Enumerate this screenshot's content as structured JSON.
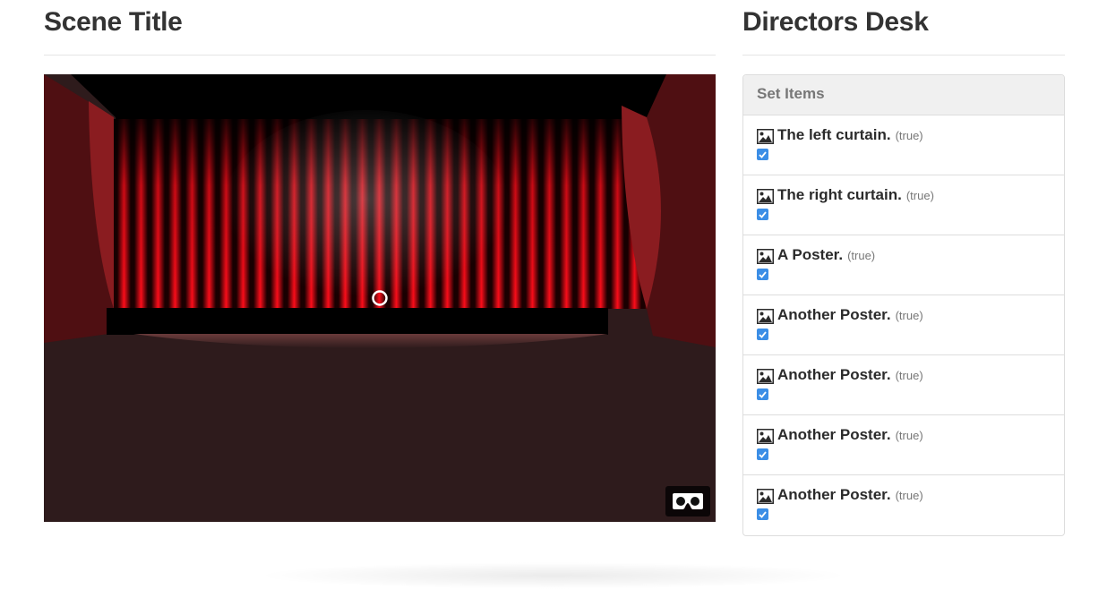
{
  "scene": {
    "title": "Scene Title",
    "vr_icon": "vr-headset-icon",
    "cursor_icon": "gaze-cursor-icon",
    "colors": {
      "curtain_red": "#ff0d1a",
      "wall_red": "#7a1416",
      "floor": "#2e1b1c",
      "ceiling": "#000000"
    }
  },
  "desk": {
    "title": "Directors Desk",
    "panel_title": "Set Items",
    "item_icon": "image-icon",
    "checkbox_color": "#3b8ee6",
    "items": [
      {
        "name": "The left curtain.",
        "state": "(true)",
        "checked": true
      },
      {
        "name": "The right curtain.",
        "state": "(true)",
        "checked": true
      },
      {
        "name": "A Poster.",
        "state": "(true)",
        "checked": true
      },
      {
        "name": "Another Poster.",
        "state": "(true)",
        "checked": true
      },
      {
        "name": "Another Poster.",
        "state": "(true)",
        "checked": true
      },
      {
        "name": "Another Poster.",
        "state": "(true)",
        "checked": true
      },
      {
        "name": "Another Poster.",
        "state": "(true)",
        "checked": true
      }
    ]
  }
}
